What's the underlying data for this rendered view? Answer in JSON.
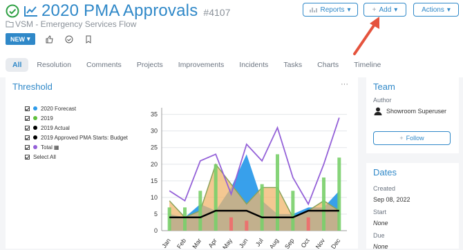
{
  "header": {
    "title": "2020 PMA Approvals",
    "number": "#4107",
    "flow": "VSM - Emergency Services Flow",
    "badge": "NEW",
    "buttons": {
      "reports": "Reports",
      "add": "Add",
      "actions": "Actions"
    }
  },
  "tabs": [
    "All",
    "Resolution",
    "Comments",
    "Projects",
    "Improvements",
    "Incidents",
    "Tasks",
    "Charts",
    "Timeline"
  ],
  "threshold": {
    "title": "Threshold",
    "more": "···",
    "legend": [
      {
        "label": "2020 Forecast",
        "color": "#2d9bea"
      },
      {
        "label": "2019",
        "color": "#5fbf3c"
      },
      {
        "label": "2019 Actual",
        "color": "#000000"
      },
      {
        "label": "2019 Approved PMA Starts: Budget",
        "color": "#000000"
      },
      {
        "label": "Total",
        "color": "#9461d8"
      },
      {
        "label": "Select All",
        "color": ""
      }
    ]
  },
  "chart_data": {
    "type": "area",
    "categories": [
      "Jan",
      "Feb",
      "Mar",
      "Apr",
      "May",
      "Jun",
      "Jul",
      "Aug",
      "Sep",
      "Oct",
      "Nov",
      "Dec"
    ],
    "ylim": [
      0,
      37
    ],
    "yticks": [
      0,
      5,
      10,
      15,
      20,
      25,
      30,
      35
    ],
    "series": [
      {
        "name": "2020 Forecast",
        "kind": "area",
        "color": "#2d9bea",
        "values": [
          5,
          4,
          8,
          6,
          13,
          23,
          9,
          5,
          5,
          7,
          7,
          12
        ]
      },
      {
        "name": "2019",
        "kind": "area",
        "color": "#f0b56e",
        "values": [
          9,
          4,
          6,
          20,
          14,
          8,
          13,
          13,
          4,
          6,
          9,
          6
        ]
      },
      {
        "name": "2019 Actual",
        "kind": "line",
        "color": "#000000",
        "values": [
          4,
          4,
          4,
          6,
          6,
          6,
          4,
          4,
          4,
          6,
          6,
          6
        ]
      },
      {
        "name": "Total",
        "kind": "line",
        "color": "#9461d8",
        "values": [
          12,
          9,
          21,
          23,
          11,
          26,
          21,
          31,
          16,
          8,
          20,
          34
        ]
      },
      {
        "name": "Bars",
        "kind": "bar",
        "values": [
          7,
          7,
          12,
          20,
          4,
          3,
          14,
          23,
          12,
          4,
          16,
          22
        ],
        "colors": [
          "#79cf6a",
          "#79cf6a",
          "#79cf6a",
          "#79cf6a",
          "#f06b6b",
          "#f06b6b",
          "#79cf6a",
          "#79cf6a",
          "#79cf6a",
          "#f06b6b",
          "#79cf6a",
          "#79cf6a"
        ]
      }
    ]
  },
  "team": {
    "title": "Team",
    "author_label": "Author",
    "author_name": "Showroom Superuser",
    "follow": "Follow"
  },
  "dates": {
    "title": "Dates",
    "created_label": "Created",
    "created": "Sep 08, 2022",
    "start_label": "Start",
    "start": "None",
    "due_label": "Due",
    "due": "None"
  }
}
